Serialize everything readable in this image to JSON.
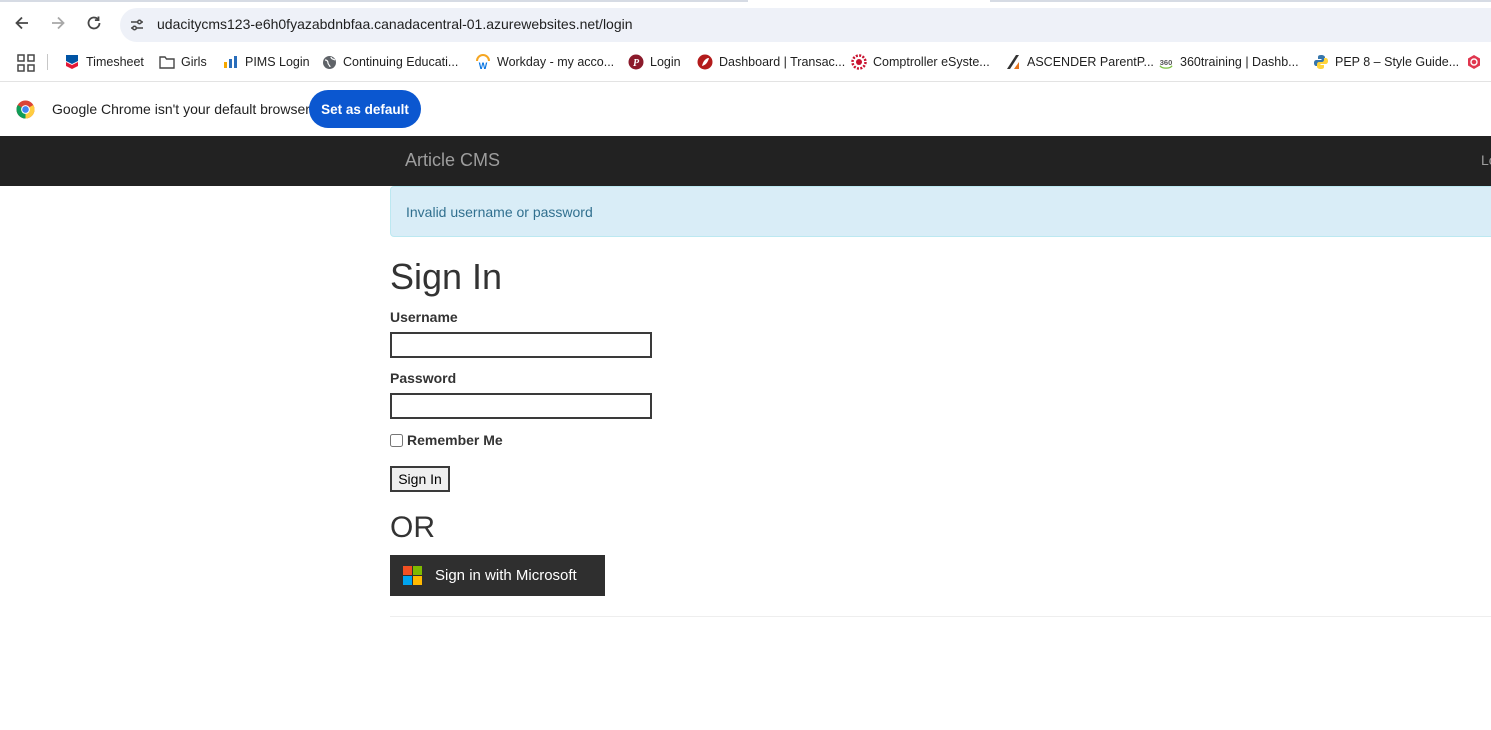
{
  "browser": {
    "url": "udacitycms123-e6h0fyazabdnbfaa.canadacentral-01.azurewebsites.net/login",
    "bookmarks": [
      {
        "label": "Timesheet",
        "icon": "chevron-logo-icon"
      },
      {
        "label": "Girls",
        "icon": "folder-icon"
      },
      {
        "label": "PIMS Login",
        "icon": "bar-chart-icon"
      },
      {
        "label": "Continuing Educati...",
        "icon": "globe-icon"
      },
      {
        "label": "Workday - my acco...",
        "icon": "workday-icon"
      },
      {
        "label": "Login",
        "icon": "p-logo-icon"
      },
      {
        "label": "Dashboard | Transac...",
        "icon": "red-leaf-icon"
      },
      {
        "label": "Comptroller eSyste...",
        "icon": "red-seal-icon"
      },
      {
        "label": "ASCENDER ParentP...",
        "icon": "ascender-icon"
      },
      {
        "label": "360training | Dashb...",
        "icon": "360-icon"
      },
      {
        "label": "PEP 8 – Style Guide...",
        "icon": "python-icon"
      }
    ],
    "infobar": {
      "message": "Google Chrome isn't your default browser",
      "button": "Set as default"
    }
  },
  "site": {
    "brand": "Article CMS",
    "nav_right": "Lo",
    "alert": "Invalid username or password",
    "form": {
      "title": "Sign In",
      "username_label": "Username",
      "username_value": "",
      "password_label": "Password",
      "password_value": "",
      "remember_label": "Remember Me",
      "remember_checked": false,
      "submit": "Sign In",
      "or": "OR",
      "microsoft_button": "Sign in with Microsoft"
    }
  },
  "colors": {
    "navbar": "#222222",
    "alert_bg": "#d9edf7",
    "alert_text": "#31708f",
    "chrome_blue": "#0b57d0",
    "ms_button": "#2f2f2f",
    "ms_red": "#f25022",
    "ms_green": "#7fba00",
    "ms_blue": "#00a4ef",
    "ms_yellow": "#ffb900"
  }
}
